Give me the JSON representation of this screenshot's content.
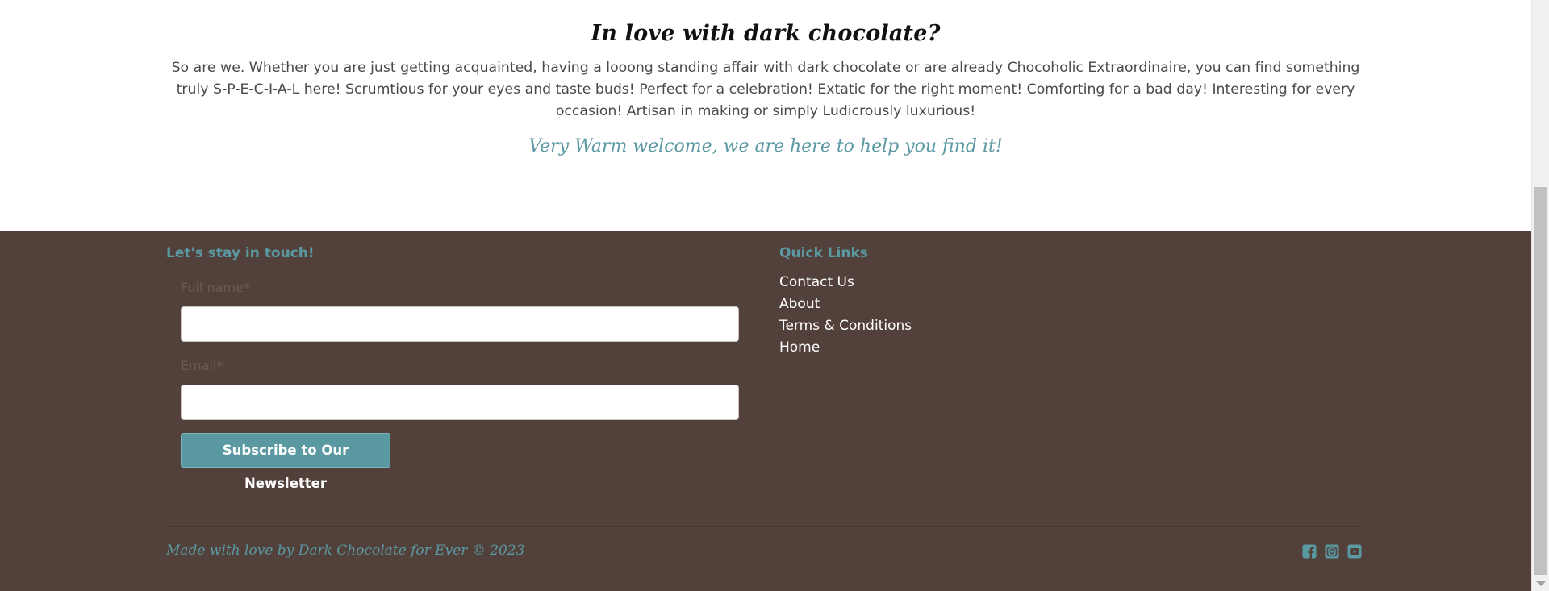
{
  "intro": {
    "title": "In love with dark chocolate?",
    "body": "So are we. Whether you are just getting acquainted, having a looong standing affair with dark chocolate or are already Chocoholic Extraordinaire, you can find something truly S-P-E-C-I-A-L here! Scrumtious for your eyes and taste buds! Perfect for a celebration! Extatic for the right moment! Comforting for a bad day! Interesting for every occasion! Artisan in making or simply Ludicrously luxurious!",
    "welcome": "Very Warm welcome, we are here to help you find it!"
  },
  "footer": {
    "newsletter": {
      "heading": "Let's stay in touch!",
      "name_label": "Full name*",
      "name_value": "",
      "email_label": "Email*",
      "email_value": "",
      "submit_label": "Subscribe to Our Newsletter"
    },
    "quick_links": {
      "heading": "Quick Links",
      "items": [
        "Contact Us",
        "About",
        "Terms & Conditions",
        "Home"
      ]
    },
    "copyright": "Made with love by Dark Chocolate for Ever © 2023",
    "social": [
      {
        "icon": "facebook-icon"
      },
      {
        "icon": "instagram-icon"
      },
      {
        "icon": "youtube-icon"
      }
    ]
  },
  "colors": {
    "accent": "#5a98a2",
    "footer_bg": "#52413a",
    "body_text": "#4a4a4a"
  }
}
